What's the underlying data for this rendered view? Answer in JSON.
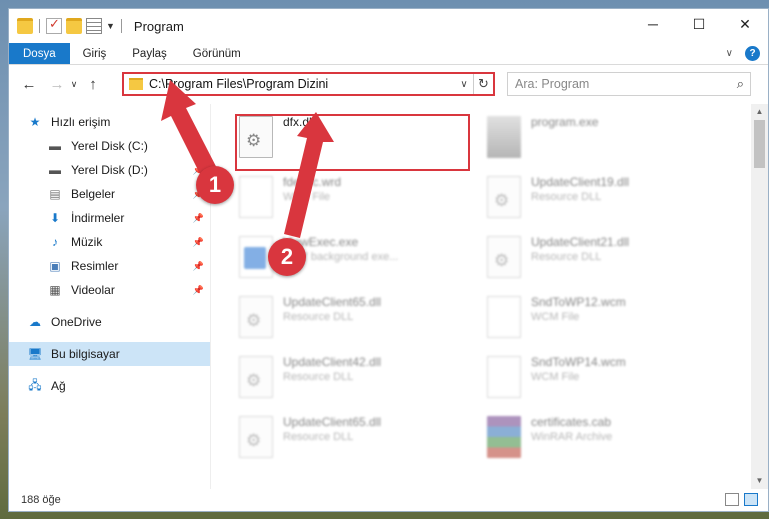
{
  "window": {
    "title": "Program"
  },
  "ribbon": {
    "tabs": [
      "Dosya",
      "Giriş",
      "Paylaş",
      "Görünüm"
    ],
    "help": "?"
  },
  "address": {
    "path": "C:\\Program Files\\Program Dizini"
  },
  "search": {
    "placeholder": "Ara: Program"
  },
  "sidebar": {
    "items": [
      {
        "label": "Hızlı erişim",
        "icon": "star-icon"
      },
      {
        "label": "Yerel Disk (C:)",
        "icon": "drive-icon",
        "pinned": true
      },
      {
        "label": "Yerel Disk (D:)",
        "icon": "drive-icon",
        "pinned": true
      },
      {
        "label": "Belgeler",
        "icon": "documents-icon",
        "pinned": true
      },
      {
        "label": "İndirmeler",
        "icon": "download-icon",
        "pinned": true
      },
      {
        "label": "Müzik",
        "icon": "music-icon",
        "pinned": true
      },
      {
        "label": "Resimler",
        "icon": "pictures-icon",
        "pinned": true
      },
      {
        "label": "Videolar",
        "icon": "videos-icon",
        "pinned": true
      },
      {
        "label": "OneDrive",
        "icon": "cloud-icon"
      },
      {
        "label": "Bu bilgisayar",
        "icon": "computer-icon",
        "selected": true
      },
      {
        "label": "Ağ",
        "icon": "network-icon"
      }
    ]
  },
  "files": [
    {
      "name": "dfx.dll",
      "desc": ""
    },
    {
      "name": "program.exe",
      "desc": ""
    },
    {
      "name": "fdexec.wrd",
      "desc": "WRD File"
    },
    {
      "name": "UpdateClient19.dll",
      "desc": "Resource DLL"
    },
    {
      "name": "ViewExec.exe",
      "desc": "BWY background exe..."
    },
    {
      "name": "UpdateClient21.dll",
      "desc": "Resource DLL"
    },
    {
      "name": "UpdateClient65.dll",
      "desc": "Resource DLL"
    },
    {
      "name": "SndToWP12.wcm",
      "desc": "WCM File"
    },
    {
      "name": "UpdateClient42.dll",
      "desc": "Resource DLL"
    },
    {
      "name": "SndToWP14.wcm",
      "desc": "WCM File"
    },
    {
      "name": "UpdateClient65.dll",
      "desc": "Resource DLL"
    },
    {
      "name": "certificates.cab",
      "desc": "WinRAR Archive"
    }
  ],
  "status": {
    "count": "188 öğe"
  },
  "annotations": {
    "step1": "1",
    "step2": "2",
    "color": "#d9363e"
  }
}
